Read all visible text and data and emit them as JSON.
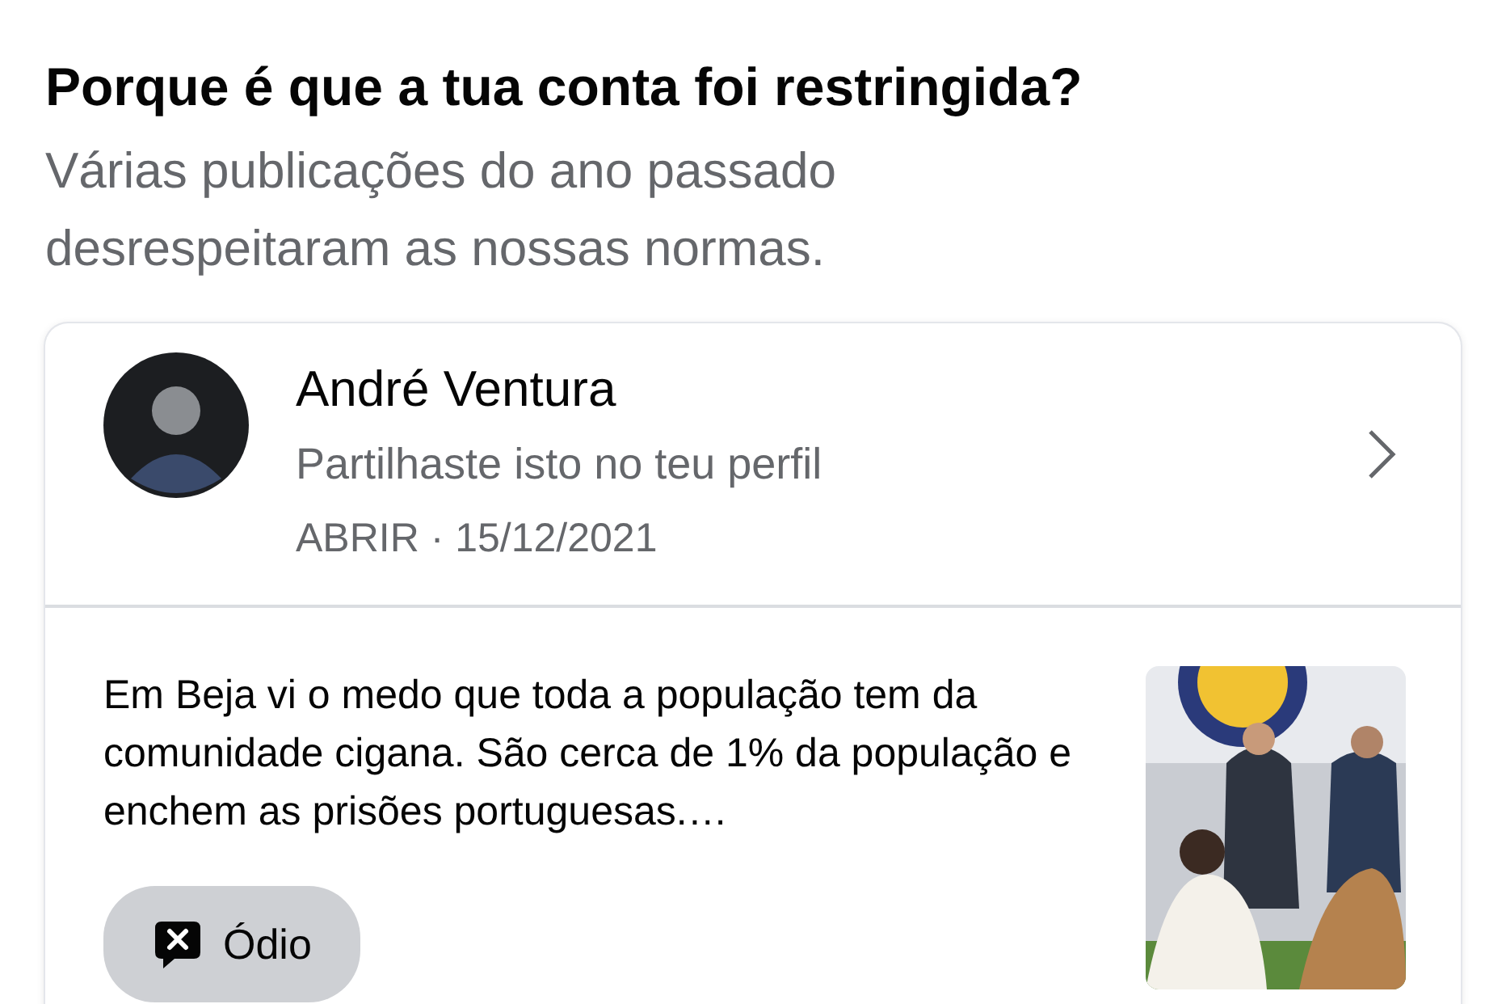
{
  "heading": "Porque é que a tua conta foi restringida?",
  "subheading": "Várias publicações do ano passado desrespeitaram as nossas normas.",
  "post": {
    "author": "André Ventura",
    "context": "Partilhaste isto no teu perfil",
    "meta": "ABRIR · 15/12/2021",
    "text": "Em Beja vi o medo que toda a população tem da comunidade cigana. São cerca de 1% da população e enchem as prisões portuguesas.…",
    "tag": "Ódio"
  }
}
